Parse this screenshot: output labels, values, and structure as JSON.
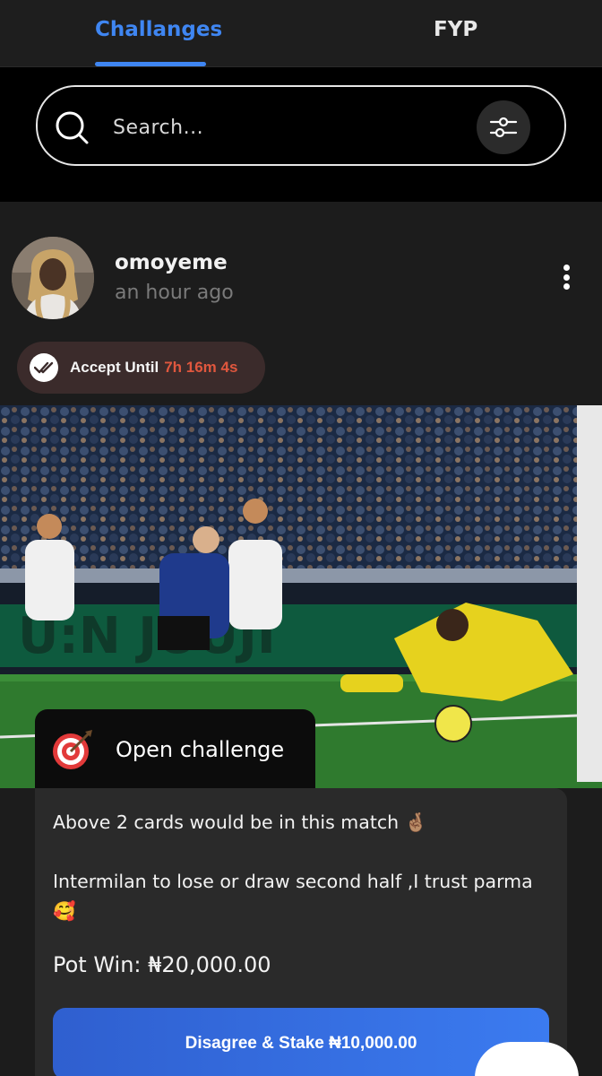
{
  "tabs": [
    {
      "label": "Challanges",
      "active": true
    },
    {
      "label": "FYP",
      "active": false
    }
  ],
  "search": {
    "placeholder": "Search..."
  },
  "post": {
    "username": "omoyeme",
    "timestamp": "an hour ago",
    "accept_label": "Accept Until",
    "countdown": "7h 16m 4s",
    "challenge_type": "Open challenge",
    "description": "Above 2 cards would be in this match 🤞🏽\n\nIntermilan to lose or draw second half ,I trust parma🥰",
    "pot_win": "Pot Win: ₦20,000.00",
    "stake_button": "Disagree & Stake ₦10,000.00"
  },
  "colors": {
    "accent": "#3f86f2",
    "countdown": "#e0573e",
    "button_start": "#2f5fcf",
    "button_end": "#3b7bf0",
    "card_bg": "#2a2a2a"
  },
  "icons": [
    "search-icon",
    "filter-icon",
    "more-vertical-icon",
    "double-check-icon",
    "target-icon"
  ]
}
